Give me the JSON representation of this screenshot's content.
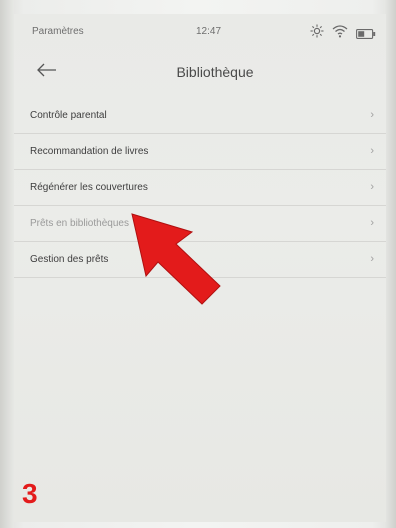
{
  "statusbar": {
    "section_label": "Paramètres",
    "time": "12:47",
    "icons": [
      "brightness-icon",
      "wifi-icon",
      "battery-icon"
    ]
  },
  "header": {
    "title": "Bibliothèque",
    "back_icon": "arrow-left-icon"
  },
  "menu": {
    "items": [
      {
        "label": "Contrôle parental"
      },
      {
        "label": "Recommandation de livres"
      },
      {
        "label": "Régénérer les couvertures"
      },
      {
        "label": "Prêts en bibliothèques"
      },
      {
        "label": "Gestion des prêts"
      }
    ],
    "chevron": "›"
  },
  "annotation": {
    "step": "3",
    "arrow_color": "#e31b1b"
  }
}
